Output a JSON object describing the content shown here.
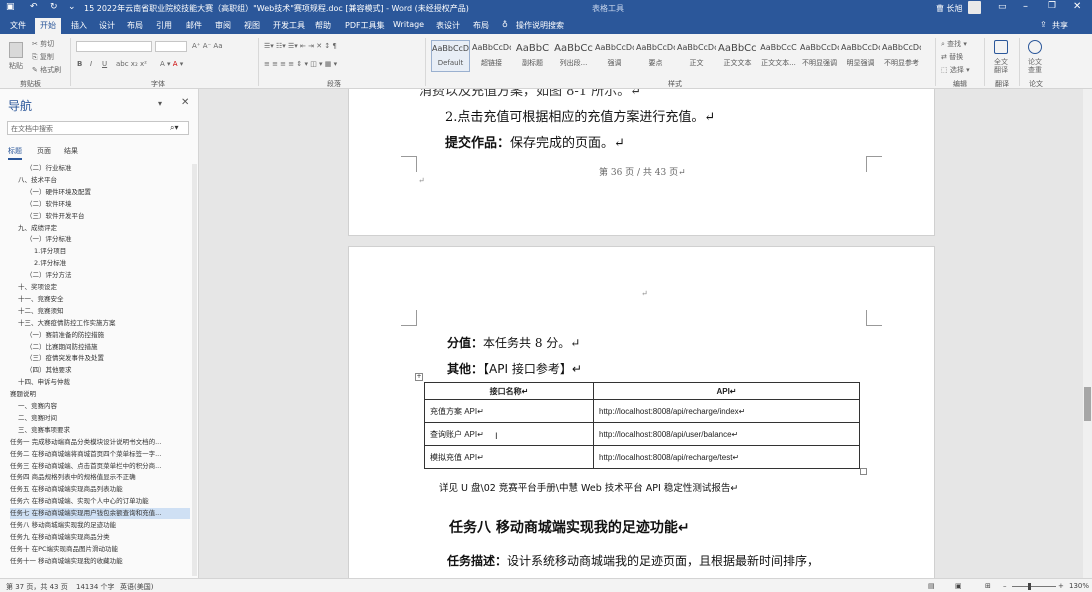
{
  "window": {
    "title": "15 2022年云南省职业院校技能大赛（高职组）\"Web技术\"赛项规程.doc [兼容模式] - Word (未经授权产品)",
    "table_tools": "表格工具",
    "user": "曹 长旭",
    "share": "共享"
  },
  "tabs": [
    "文件",
    "开始",
    "插入",
    "设计",
    "布局",
    "引用",
    "邮件",
    "审阅",
    "视图",
    "开发工具",
    "帮助",
    "PDF工具集",
    "Writage",
    "表设计",
    "布局"
  ],
  "tell_me": "操作说明搜索",
  "ribbon": {
    "clipboard": {
      "label": "剪贴板",
      "paste": "粘贴",
      "cut": "剪切",
      "copy": "复制",
      "format_painter": "格式刷"
    },
    "font": {
      "label": "字体"
    },
    "paragraph": {
      "label": "段落"
    },
    "styles": {
      "label": "样式",
      "items": [
        {
          "preview": "AaBbCcDd",
          "name": "Default"
        },
        {
          "preview": "AaBbCcDd",
          "name": "超链接"
        },
        {
          "preview": "AaBbC",
          "name": "副标题"
        },
        {
          "preview": "AaBbCc",
          "name": "列出段..."
        },
        {
          "preview": "AaBbCcDd",
          "name": "强调"
        },
        {
          "preview": "AaBbCcDd",
          "name": "要点"
        },
        {
          "preview": "AaBbCcDc",
          "name": "正文"
        },
        {
          "preview": "AaBbCcI",
          "name": "正文文本"
        },
        {
          "preview": "AaBbCcC",
          "name": "正文文本..."
        },
        {
          "preview": "AaBbCcDd",
          "name": "不明显强调"
        },
        {
          "preview": "AaBbCcDd",
          "name": "明显强调"
        },
        {
          "preview": "AaBbCcDd",
          "name": "不明显参考"
        }
      ]
    },
    "editing": {
      "label": "编辑",
      "find": "查找",
      "replace": "替换",
      "select": "选择"
    },
    "translate": {
      "label": "翻译",
      "btn": "全文\n翻译"
    },
    "paper": {
      "label": "论文",
      "btn": "论文\n查重"
    }
  },
  "nav": {
    "title": "导航",
    "search_placeholder": "在文档中搜索",
    "tabs": [
      "标题",
      "页面",
      "结果"
    ],
    "items": [
      "（二）行业标准",
      "八、技术平台",
      "（一）硬件环境及配置",
      "（二）软件环境",
      "（三）软件开发平台",
      "九、成绩评定",
      "（一）评分标准",
      "1.评分项目",
      "2.评分标准",
      "（二）评分方法",
      "十、奖项设定",
      "十一、竞赛安全",
      "十二、竞赛须知",
      "十三、大赛疫情防控工作实施方案",
      "（一）赛前准备的防控措施",
      "（二）比赛期间防控措施",
      "（三）疫情突发事件及处置",
      "（四）其他要求",
      "十四、申诉与仲裁",
      "赛题说明",
      "一、竞赛内容",
      "二、竞赛时间",
      "三、竞赛事项要求",
      "任务一 完成移动端商品分类模块设计说明书文档的...",
      "任务二 在移动商城端将商城首页四个菜单标签一字...",
      "任务三 在移动商城端、点击首页菜单栏中的积分商...",
      "任务四 商品规格列表中的规格值显示不正确",
      "任务五 在移动商城端实现商品列表功能",
      "任务六 在移动商城端、实现个人中心的订单功能",
      "任务七 在移动商城端实现用户钱包余额查询和充值...",
      "任务八 移动商城端实现我的足迹功能",
      "任务九 在移动商城端实现商品分类",
      "任务十 在PC端实现商品图片滑动功能",
      "任务十一 移动商城端实现我的收藏功能"
    ],
    "selected_index": 29
  },
  "page1": {
    "partial_top": "消费以及充值方案，如图 8-1 所示。↵",
    "step2": "2.点击充值可根据相应的充值方案进行充值。↵",
    "submit_label": "提交作品：",
    "submit_text": "保存完成的页面。↵",
    "footer": "第 36 页 / 共 43 页↵"
  },
  "page2": {
    "score_label": "分值：",
    "score_text": "本任务共 8 分。↵",
    "other_label": "其他：",
    "other_text": "【API 接口参考】↵",
    "table": {
      "headers": [
        "接口名称↵",
        "API↵"
      ],
      "rows": [
        [
          "充值方案 API↵",
          "http://localhost:8008/api/recharge/index↵"
        ],
        [
          "查询账户 API↵",
          "http://localhost:8008/api/user/balance↵"
        ],
        [
          "模拟充值 API↵",
          "http://localhost:8008/api/recharge/test↵"
        ]
      ]
    },
    "see_also": "详见 U 盘\\02 竞赛平台手册\\中慧 Web 技术平台 API 稳定性测试报告↵",
    "heading": "任务八  移动商城端实现我的足迹功能↵",
    "desc_label": "任务描述：",
    "desc_text": "设计系统移动商城端我的足迹页面，且根据最新时间排序，"
  },
  "status": {
    "page": "第 37 页，共 43 页",
    "words": "14134 个字",
    "lang": "英语(美国)",
    "zoom": "130%"
  }
}
